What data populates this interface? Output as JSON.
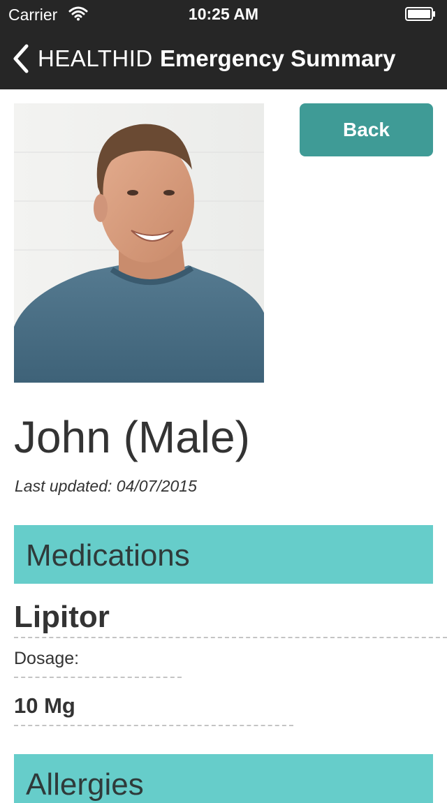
{
  "status_bar": {
    "carrier": "Carrier",
    "time": "10:25 AM",
    "wifi_icon": "wifi-icon",
    "battery_icon": "battery-icon"
  },
  "nav": {
    "back_icon": "chevron-left-icon",
    "back_label": "HEALTHID",
    "title": "Emergency Summary"
  },
  "profile": {
    "photo": "profile-photo",
    "back_button_label": "Back",
    "name": "John (Male)",
    "last_updated": "Last updated: 04/07/2015"
  },
  "medications": {
    "header": "Medications",
    "items": [
      {
        "name": "Lipitor",
        "dosage_label": "Dosage:",
        "dosage_value": "10 Mg"
      }
    ]
  },
  "allergies": {
    "header": "Allergies"
  },
  "colors": {
    "nav_background": "#262626",
    "accent_button": "#3f9b96",
    "section_header": "#66cdca",
    "text": "#333333"
  }
}
